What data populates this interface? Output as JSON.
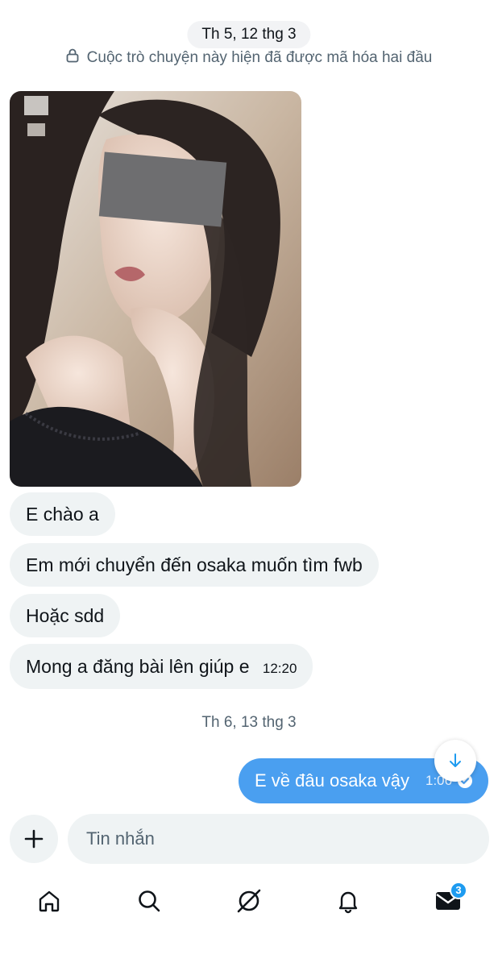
{
  "conversation": {
    "date_top": "Th 5, 12 thg 3",
    "encryption_notice": "Cuộc trò chuyện này hiện đã được mã hóa hai đầu",
    "incoming": [
      {
        "text": "E chào a",
        "time": ""
      },
      {
        "text": "Em mới chuyển đến osaka muốn tìm fwb",
        "time": ""
      },
      {
        "text": "Hoặc sdd",
        "time": ""
      },
      {
        "text": "Mong a đăng bài lên giúp e",
        "time": "12:20"
      }
    ],
    "date_second": "Th 6, 13 thg 3",
    "outgoing": {
      "text": "E về đâu osaka vậy",
      "time": "1:06"
    }
  },
  "composer": {
    "placeholder": "Tin nhắn"
  },
  "tabbar": {
    "items": [
      {
        "icon": "home-icon"
      },
      {
        "icon": "search-icon"
      },
      {
        "icon": "grok-icon"
      },
      {
        "icon": "bell-icon"
      },
      {
        "icon": "mail-icon",
        "badge": "3"
      }
    ]
  },
  "colors": {
    "accent": "#1d9bf0",
    "outgoing_bubble": "#4a9ff0",
    "incoming_bubble": "#eff3f4",
    "secondary_text": "#536471"
  }
}
